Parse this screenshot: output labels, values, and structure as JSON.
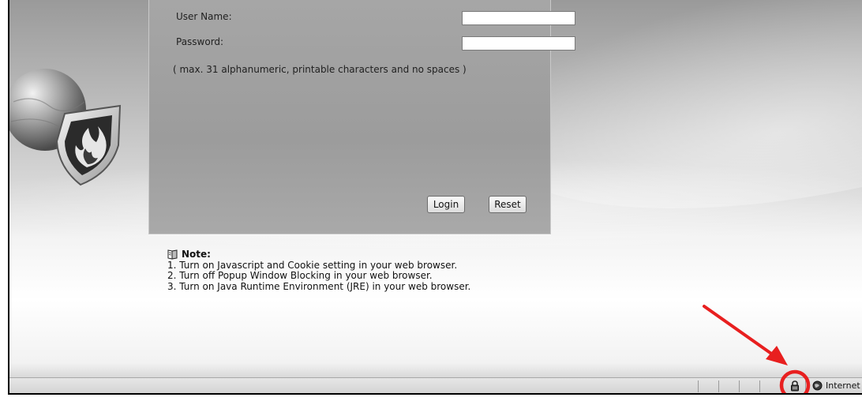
{
  "login": {
    "username_label": "User Name:",
    "password_label": "Password:",
    "username_value": "",
    "password_value": "",
    "hint": "( max. 31 alphanumeric, printable characters and no spaces )",
    "login_button": "Login",
    "reset_button": "Reset"
  },
  "note": {
    "title": "Note:",
    "items": [
      "1. Turn on Javascript and Cookie setting in your web browser.",
      "2. Turn off Popup Window Blocking in your web browser.",
      "3. Turn on Java Runtime Environment (JRE) in your web browser."
    ]
  },
  "statusbar": {
    "security_icon": "lock-icon",
    "zone_icon": "internet-zone-icon",
    "zone_label": "Internet"
  },
  "annotation": {
    "color": "#e81f1f",
    "shape": "circle-and-arrow"
  }
}
